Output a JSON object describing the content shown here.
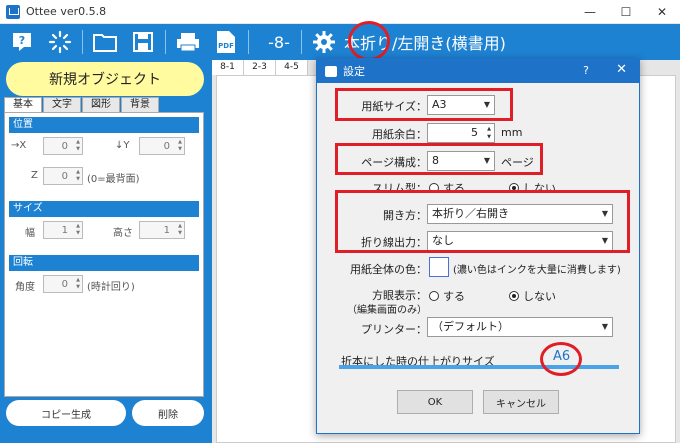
{
  "window": {
    "title": "Ottee ver0.5.8",
    "minimize": "—",
    "maximize": "☐",
    "close": "✕"
  },
  "toolbar": {
    "page_indicator": "-8-",
    "fold_mode": "本折り/左開き(横書用)",
    "pdf_label": "PDF"
  },
  "left_panel": {
    "new_object": "新規オブジェクト",
    "tabs": [
      "基本",
      "文字",
      "図形",
      "背景"
    ],
    "position": {
      "header": "位置",
      "x_label": "→X",
      "x_value": "0",
      "y_label": "↓Y",
      "y_value": "0",
      "z_label": "Z",
      "z_value": "0",
      "z_note": "(0=最背面)"
    },
    "size": {
      "header": "サイズ",
      "width_label": "幅",
      "width_value": "1",
      "height_label": "高さ",
      "height_value": "1"
    },
    "rotation": {
      "header": "回転",
      "angle_label": "角度",
      "angle_value": "0",
      "angle_note": "(時計回り)"
    },
    "copy_button": "コピー生成",
    "delete_button": "削除"
  },
  "canvas": {
    "page_tabs": [
      "8-1",
      "2-3",
      "4-5"
    ]
  },
  "dialog": {
    "title": "設定",
    "help": "?",
    "close": "✕",
    "paper_size_label": "用紙サイズ：",
    "paper_size_value": "A3",
    "margin_label": "用紙余白：",
    "margin_value": "5",
    "margin_unit": "mm",
    "page_config_label": "ページ構成：",
    "page_config_value": "8",
    "page_config_unit": "ページ",
    "slim_label": "スリム型：",
    "slim_yes": "する",
    "slim_no": "しない",
    "open_label": "開き方：",
    "open_value": "本折り／右開き",
    "fold_line_label": "折り線出力：",
    "fold_line_value": "なし",
    "paper_color_label": "用紙全体の色：",
    "paper_color_note": "(濃い色はインクを大量に消費します)",
    "grid_label": "方眼表示：",
    "grid_sub": "（編集画面のみ）",
    "grid_yes": "する",
    "grid_no": "しない",
    "printer_label": "プリンター：",
    "printer_value": "（デフォルト）",
    "result_label": "折本にした時の仕上がりサイズ",
    "result_value": "A6",
    "ok": "OK",
    "cancel": "キャンセル"
  },
  "colors": {
    "accent": "#1e82d2",
    "highlight": "#e01e27",
    "button_yellow": "#fffb9e"
  }
}
